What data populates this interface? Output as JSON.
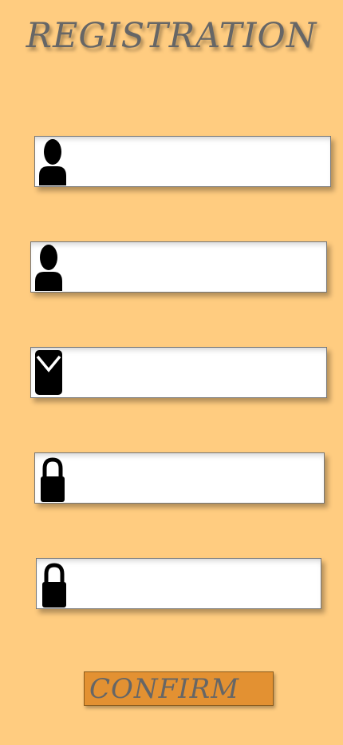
{
  "header": {
    "title": "REGISTRATION"
  },
  "form": {
    "fields": [
      {
        "icon": "user-icon",
        "value": "",
        "placeholder": ""
      },
      {
        "icon": "user-icon",
        "value": "",
        "placeholder": ""
      },
      {
        "icon": "email-icon",
        "value": "",
        "placeholder": ""
      },
      {
        "icon": "lock-icon",
        "value": "",
        "placeholder": ""
      },
      {
        "icon": "lock-icon",
        "value": "",
        "placeholder": ""
      }
    ],
    "confirm_label": "CONFIRM"
  },
  "colors": {
    "background": "#ffcc80",
    "button": "#e39132",
    "text": "#666666",
    "icon": "#000000"
  }
}
